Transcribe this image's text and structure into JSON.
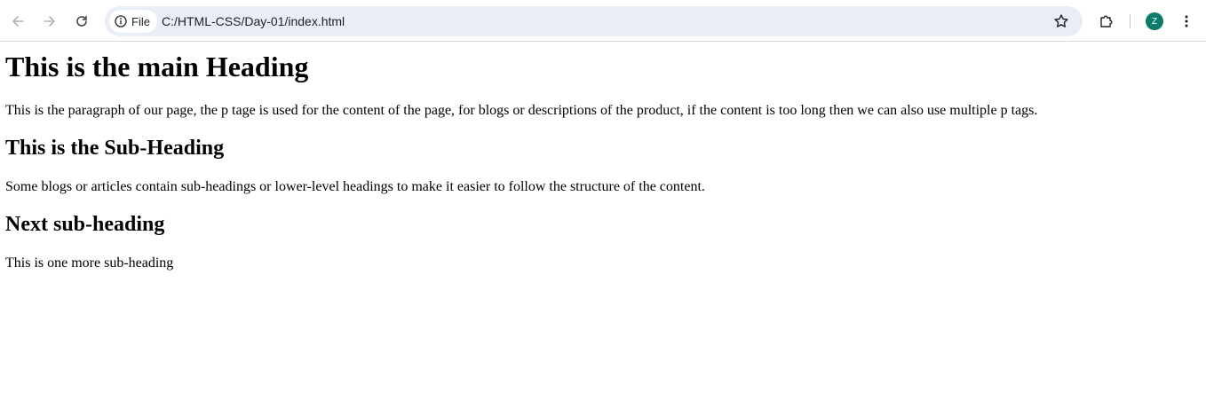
{
  "browser": {
    "back_icon": "arrow-left-icon",
    "forward_icon": "arrow-right-icon",
    "reload_icon": "reload-icon",
    "site_info_label": "File",
    "url": "C:/HTML-CSS/Day-01/index.html",
    "bookmark_icon": "star-icon",
    "extensions_icon": "puzzle-icon",
    "profile_initial": "Z",
    "profile_color": "#0b7d6a",
    "menu_icon": "kebab-menu-icon"
  },
  "page": {
    "main_heading": "This is the main Heading",
    "paragraph_1": "This is the paragraph of our page, the p tage is used for the content of the page, for blogs or descriptions of the product, if the content is too long then we can also use multiple p tags.",
    "sub_heading_1": "This is the Sub-Heading",
    "paragraph_2": "Some blogs or articles contain sub-headings or lower-level headings to make it easier to follow the structure of the content.",
    "sub_heading_2": "Next sub-heading",
    "paragraph_3": "This is one more sub-heading"
  }
}
